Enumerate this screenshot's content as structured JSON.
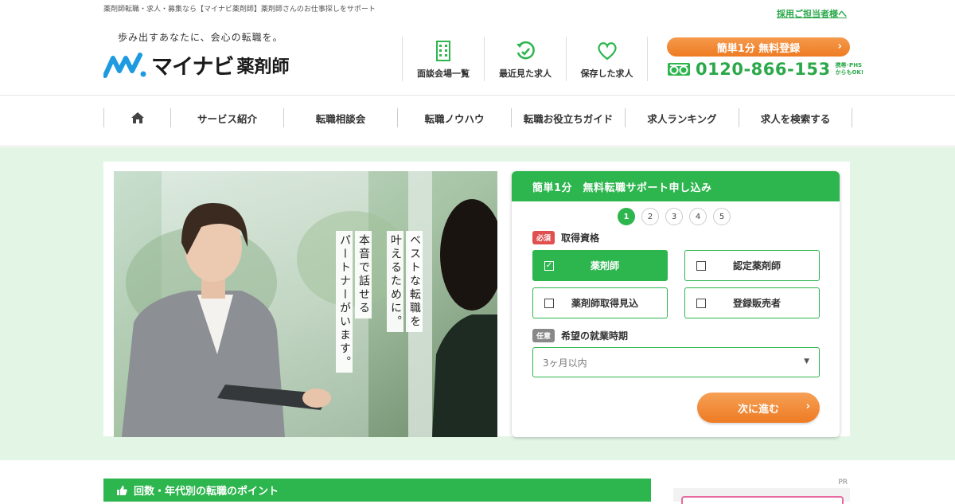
{
  "header": {
    "topline": "薬剤師転職・求人・募集なら【マイナビ薬剤師】薬剤師さんのお仕事探しをサポート",
    "recruit_link": "採用ご担当者様へ",
    "tagline": "歩み出すあなたに、会心の転職を。",
    "logo_main": "マイナビ",
    "logo_sub": "薬剤師",
    "nav": [
      {
        "label": "面談会場一覧",
        "icon": "building-icon"
      },
      {
        "label": "最近見た求人",
        "icon": "history-icon"
      },
      {
        "label": "保存した求人",
        "icon": "heart-icon"
      }
    ],
    "register_label": "簡単1分 無料登録",
    "phone": "0120-866-153",
    "phone_note_1": "携帯･PHS",
    "phone_note_2": "からもOK!"
  },
  "gnav": {
    "home_icon": "home-icon",
    "items": [
      "サービス紹介",
      "転職相談会",
      "転職ノウハウ",
      "転職お役立ちガイド",
      "求人ランキング",
      "求人を検索する"
    ]
  },
  "hero": {
    "copy_lines": [
      "ベストな転職を",
      "叶えるために。",
      "本音で話せる",
      "パートナーがいます。"
    ]
  },
  "form": {
    "title": "簡単1分　無料転職サポート申し込み",
    "steps": [
      "1",
      "2",
      "3",
      "4",
      "5"
    ],
    "active_step": 1,
    "q1": {
      "badge": "必須",
      "label": "取得資格"
    },
    "options": [
      {
        "label": "薬剤師",
        "checked": true
      },
      {
        "label": "認定薬剤師",
        "checked": false
      },
      {
        "label": "薬剤師取得見込",
        "checked": false
      },
      {
        "label": "登録販売者",
        "checked": false
      }
    ],
    "q2": {
      "badge": "任意",
      "label": "希望の就業時期"
    },
    "select_value": "3ヶ月以内",
    "next_label": "次に進む"
  },
  "section": {
    "title": "回数・年代別の転職のポイント"
  },
  "pr_label": "PR",
  "colors": {
    "brand_green": "#2db54e",
    "accent_orange": "#ee7b23",
    "hero_bg": "#e3f6e6"
  }
}
